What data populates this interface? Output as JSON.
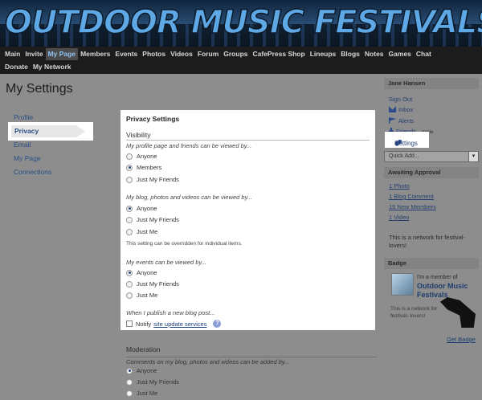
{
  "banner": {
    "title": "OUTDOOR MUSIC FESTIVALS"
  },
  "nav": {
    "row1": [
      "Main",
      "Invite",
      "My Page",
      "Members",
      "Events",
      "Photos",
      "Videos",
      "Forum",
      "Groups",
      "CafePress Shop",
      "Lineups",
      "Blogs",
      "Notes",
      "Games",
      "Chat"
    ],
    "row2": [
      "Donate",
      "My Network"
    ],
    "active": "My Page"
  },
  "page": {
    "title": "My Settings"
  },
  "left_nav": {
    "items": [
      "Profile",
      "Privacy",
      "Email",
      "My Page",
      "Connections"
    ],
    "active": "Privacy"
  },
  "privacy": {
    "title": "Privacy Settings",
    "visibility_label": "Visibility",
    "q1": {
      "question": "My profile page and friends can be viewed by...",
      "options": [
        "Anyone",
        "Members",
        "Just My Friends"
      ],
      "selected": "Members"
    },
    "q2": {
      "question": "My blog, photos and videos can be viewed by...",
      "options": [
        "Anyone",
        "Just My Friends",
        "Just Me"
      ],
      "selected": "Anyone"
    },
    "q2_note": "This setting can be overridden for individual items.",
    "q3": {
      "question": "My events can be viewed by...",
      "options": [
        "Anyone",
        "Just My Friends",
        "Just Me"
      ],
      "selected": "Anyone"
    },
    "q4": {
      "question": "When I publish a new blog post...",
      "notify_label": "Notify",
      "notify_link": "site update services",
      "checked": false
    }
  },
  "moderation": {
    "label": "Moderation",
    "question": "Comments on my blog, photos and videos can be added by...",
    "options": [
      "Anyone",
      "Just My Friends",
      "Just Me"
    ],
    "selected": "Anyone"
  },
  "sidebar": {
    "user": "Jane Hansen",
    "sign_out": "Sign Out",
    "inbox": "Inbox",
    "alerts": "Alerts",
    "friends": "Friends",
    "friends_invite": "– Invite",
    "settings": "Settings",
    "quick_add": "Quick Add...",
    "awaiting_title": "Awaiting Approval",
    "awaiting": [
      "1 Photo",
      "1 Blog Comment",
      "15 New Members",
      "1 Video"
    ],
    "network_desc": "This is a network for festival-lovers!",
    "badge_title": "Badge",
    "badge_member": "I'm a member of",
    "badge_name": "Outdoor Music Festivals",
    "badge_desc": "This is a network for festival- lovers!",
    "get_badge": "Get Badge"
  }
}
